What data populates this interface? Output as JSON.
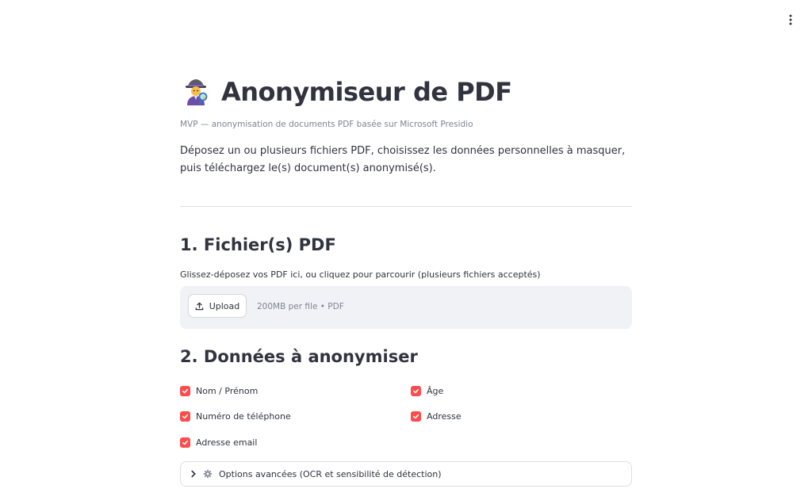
{
  "header": {
    "menu_icon": "more-vertical-icon"
  },
  "title": {
    "emoji_icon": "detective-emoji-icon",
    "text": "Anonymiseur de PDF"
  },
  "caption": "MVP — anonymisation de documents PDF basée sur Microsoft Presidio",
  "intro": "Déposez un ou plusieurs fichiers PDF, choisissez les données personnelles à masquer, puis téléchargez le(s) document(s) anonymisé(s).",
  "section1": {
    "heading": "1. Fichier(s) PDF",
    "uploader_label": "Glissez-déposez vos PDF ici, ou cliquez pour parcourir (plusieurs fichiers acceptés)",
    "upload_button": "Upload",
    "upload_hint": "200MB per file • PDF"
  },
  "section2": {
    "heading": "2. Données à anonymiser",
    "checkboxes": [
      {
        "label": "Nom / Prénom",
        "checked": true
      },
      {
        "label": "Numéro de téléphone",
        "checked": true
      },
      {
        "label": "Adresse email",
        "checked": true
      },
      {
        "label": "Âge",
        "checked": true
      },
      {
        "label": "Adresse",
        "checked": true
      }
    ],
    "expander": {
      "label": "Options avancées (OCR et sensibilité de détection)",
      "expanded": false,
      "icon": "gear-icon"
    }
  },
  "colors": {
    "accent": "#ff4b4b",
    "text": "#31333f",
    "muted": "#808495",
    "surface": "#f0f2f6"
  }
}
